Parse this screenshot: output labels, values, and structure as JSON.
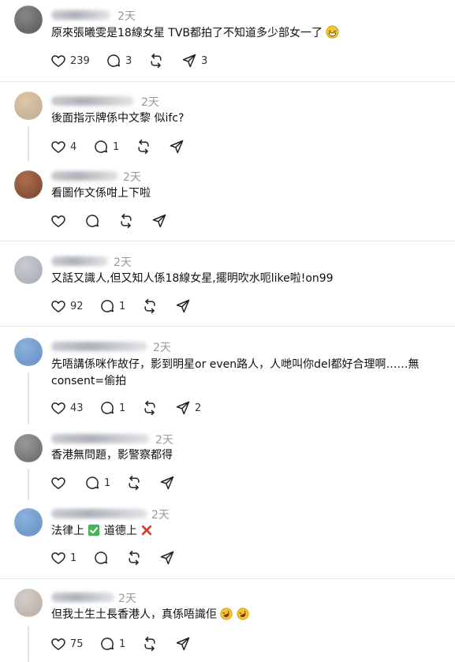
{
  "comments": [
    {
      "time": "2天",
      "text": "原來張曦雯是18線女星 TVB都拍了不知道多少部女一了",
      "emoji_after": "grinning-sweat",
      "likes": "239",
      "replies": "3",
      "shares": "3",
      "avatar_colors": [
        "#8a8a8c",
        "#4e4b4f"
      ]
    },
    {
      "time": "2天",
      "text": "後面指示牌係中文黎 似ifc?",
      "likes": "4",
      "replies": "1",
      "shares": "",
      "avatar_colors": [
        "#e0c8a8",
        "#b8a58c"
      ]
    },
    {
      "time": "2天",
      "text": "看圖作文係咁上下啦",
      "likes": "",
      "replies": "",
      "shares": "",
      "avatar_colors": [
        "#b07050",
        "#6b3a26"
      ]
    },
    {
      "time": "2天",
      "text": "又話又識人,但又知人係18線女星,擺明吹水呃like啦!on99",
      "likes": "92",
      "replies": "1",
      "shares": "",
      "avatar_colors": [
        "#c9ccd2",
        "#9ea3ab"
      ]
    },
    {
      "time": "2天",
      "text_line1": "先唔講係咪作故仔，影到明星or even路人，人哋叫你del都好合理啊……無",
      "text_line2": "consent=偷拍",
      "likes": "43",
      "replies": "1",
      "shares": "2",
      "avatar_colors": [
        "#8eb4de",
        "#5a86bd"
      ]
    },
    {
      "time": "2天",
      "text": "香港無問題，影警察都得",
      "likes": "",
      "replies": "1",
      "shares": "",
      "avatar_colors": [
        "#9c9c9c",
        "#5c5c5c"
      ]
    },
    {
      "time": "2天",
      "text_a": "法律上",
      "text_b": "道德上",
      "emoji_mid": "check-mark-button",
      "emoji_end": "cross-mark",
      "likes": "1",
      "replies": "",
      "shares": "",
      "avatar_colors": [
        "#8eb4de",
        "#5a86bd"
      ]
    },
    {
      "time": "2天",
      "text": "但我土生土長香港人，真係唔識佢",
      "emoji_after": "rolling-laughing",
      "likes": "75",
      "replies": "1",
      "shares": "",
      "avatar_colors": [
        "#d6cfca",
        "#b0a49c"
      ]
    }
  ],
  "icons": {
    "like": "heart-icon",
    "reply": "comment-bubble-icon",
    "repost": "repost-icon",
    "share": "send-icon"
  },
  "colors": {
    "timestamp": "#9a9a9a",
    "divider": "#e6e6e6",
    "thread_line": "#e3e3e3",
    "check": "#47b35a",
    "cross": "#d23c2e"
  }
}
